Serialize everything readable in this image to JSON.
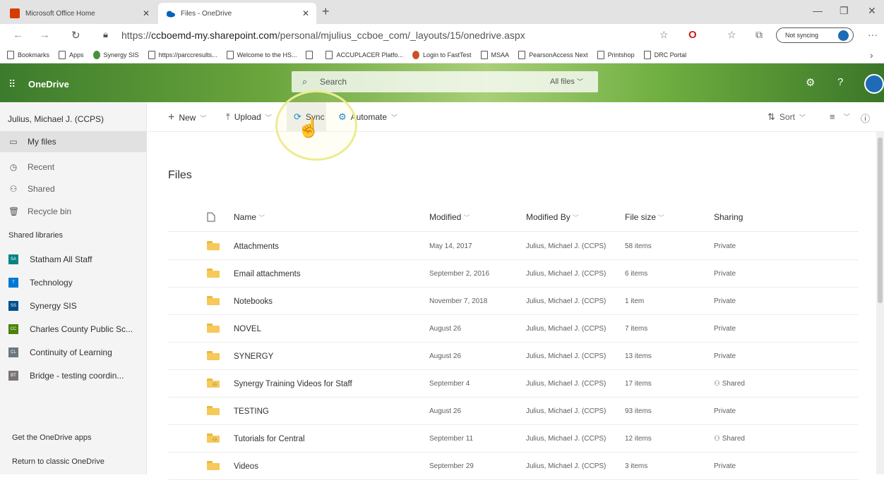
{
  "browser": {
    "tabs": [
      {
        "title": "Microsoft Office Home",
        "favicon": "office-icon",
        "favicon_color": "#d83b01"
      },
      {
        "title": "Files - OneDrive",
        "favicon": "onedrive-cloud-icon",
        "favicon_color": "#0364b8"
      }
    ],
    "url_prefix": "https://",
    "url_host": "ccboemd-my.sharepoint.com",
    "url_path": "/personal/mjulius_ccboe_com/_layouts/15/onedrive.aspx",
    "sync_status": "Not syncing",
    "bookmarks": [
      {
        "label": "Bookmarks",
        "icon": "page-icon"
      },
      {
        "label": "Apps",
        "icon": "page-icon"
      },
      {
        "label": "Synergy SIS",
        "icon": "synergy-icon",
        "color": "#4a8f3c"
      },
      {
        "label": "https://parccresults...",
        "icon": "page-icon"
      },
      {
        "label": "Welcome to the HS...",
        "icon": "page-icon"
      },
      {
        "label": "",
        "icon": "page-icon"
      },
      {
        "label": "ACCUPLACER Platfo...",
        "icon": "page-icon"
      },
      {
        "label": "Login to FastTest",
        "icon": "fasttest-icon",
        "color": "#c8512b"
      },
      {
        "label": "MSAA",
        "icon": "page-icon"
      },
      {
        "label": "PearsonAccess Next",
        "icon": "page-icon"
      },
      {
        "label": "Printshop",
        "icon": "page-icon"
      },
      {
        "label": "DRC Portal",
        "icon": "page-icon"
      }
    ]
  },
  "header": {
    "app_name": "OneDrive",
    "search_placeholder": "Search",
    "search_scope": "All files"
  },
  "leftnav": {
    "user": "Julius, Michael J. (CCPS)",
    "items": [
      {
        "label": "My files",
        "icon": "folder-icon",
        "selected": true
      },
      {
        "label": "Recent",
        "icon": "clock-icon"
      },
      {
        "label": "Shared",
        "icon": "shared-people-icon"
      },
      {
        "label": "Recycle bin",
        "icon": "recycle-bin-icon"
      }
    ],
    "libraries_header": "Shared libraries",
    "libraries": [
      {
        "label": "Statham All Staff",
        "initials": "SA",
        "color": "#038387"
      },
      {
        "label": "Technology",
        "initials": "T",
        "color": "#0078d4"
      },
      {
        "label": "Synergy SIS",
        "initials": "SS",
        "color": "#004e8c"
      },
      {
        "label": "Charles County Public Sc...",
        "initials": "CC",
        "color": "#498205"
      },
      {
        "label": "Continuity of Learning",
        "initials": "CL",
        "color": "#69797e"
      },
      {
        "label": "Bridge - testing coordin...",
        "initials": "BT",
        "color": "#7a7574"
      }
    ],
    "get_apps": "Get the OneDrive apps",
    "classic": "Return to classic OneDrive"
  },
  "commandbar": {
    "new": "New",
    "upload": "Upload",
    "sync": "Sync",
    "automate": "Automate",
    "sort": "Sort"
  },
  "files": {
    "title": "Files",
    "columns": [
      "Name",
      "Modified",
      "Modified By",
      "File size",
      "Sharing"
    ],
    "rows": [
      {
        "name": "Attachments",
        "modified": "May 14, 2017",
        "by": "Julius, Michael J. (CCPS)",
        "size": "58 items",
        "sharing": "Private",
        "shared": false
      },
      {
        "name": "Email attachments",
        "modified": "September 2, 2016",
        "by": "Julius, Michael J. (CCPS)",
        "size": "6 items",
        "sharing": "Private",
        "shared": false
      },
      {
        "name": "Notebooks",
        "modified": "November 7, 2018",
        "by": "Julius, Michael J. (CCPS)",
        "size": "1 item",
        "sharing": "Private",
        "shared": false
      },
      {
        "name": "NOVEL",
        "modified": "August 26",
        "by": "Julius, Michael J. (CCPS)",
        "size": "7 items",
        "sharing": "Private",
        "shared": false
      },
      {
        "name": "SYNERGY",
        "modified": "August 26",
        "by": "Julius, Michael J. (CCPS)",
        "size": "13 items",
        "sharing": "Private",
        "shared": false
      },
      {
        "name": "Synergy Training Videos for Staff",
        "modified": "September 4",
        "by": "Julius, Michael J. (CCPS)",
        "size": "17 items",
        "sharing": "Shared",
        "shared": true
      },
      {
        "name": "TESTING",
        "modified": "August 26",
        "by": "Julius, Michael J. (CCPS)",
        "size": "93 items",
        "sharing": "Private",
        "shared": false
      },
      {
        "name": "Tutorials for Central",
        "modified": "September 11",
        "by": "Julius, Michael J. (CCPS)",
        "size": "12 items",
        "sharing": "Shared",
        "shared": true
      },
      {
        "name": "Videos",
        "modified": "September 29",
        "by": "Julius, Michael J. (CCPS)",
        "size": "3 items",
        "sharing": "Private",
        "shared": false
      }
    ]
  }
}
